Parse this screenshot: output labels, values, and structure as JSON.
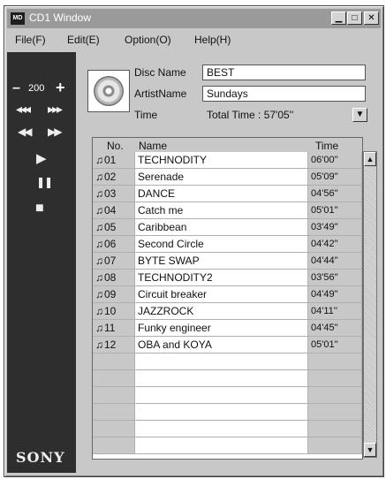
{
  "window": {
    "app_icon": "MD",
    "title": "CD1 Window",
    "min_glyph": "▁",
    "max_glyph": "□",
    "close_glyph": "✕"
  },
  "menu": {
    "file": "File(F)",
    "edit": "Edit(E)",
    "option": "Option(O)",
    "help": "Help(H)"
  },
  "controls": {
    "minus": "–",
    "volume": "200",
    "plus": "+",
    "prev_track": "◂◂◂",
    "next_track": "▸▸▸",
    "rewind": "◀◀",
    "fast_forward": "▶▶",
    "play": "▶",
    "pause": "❚❚",
    "stop": "■",
    "brand": "SONY"
  },
  "disc": {
    "disc_name_label": "Disc Name",
    "disc_name": "BEST",
    "artist_label": "ArtistName",
    "artist": "Sundays",
    "time_label": "Time",
    "time_value": "Total Time : 57'05''",
    "dropdown_glyph": "▼"
  },
  "table": {
    "col_no": "No.",
    "col_name": "Name",
    "col_time": "Time",
    "tracks": [
      {
        "no": "01",
        "name": "TECHNODITY",
        "time": "06'00''"
      },
      {
        "no": "02",
        "name": "Serenade",
        "time": "05'09''"
      },
      {
        "no": "03",
        "name": "DANCE",
        "time": "04'56''"
      },
      {
        "no": "04",
        "name": "Catch me",
        "time": "05'01''"
      },
      {
        "no": "05",
        "name": "Caribbean",
        "time": "03'49''"
      },
      {
        "no": "06",
        "name": "Second Circle",
        "time": "04'42''"
      },
      {
        "no": "07",
        "name": "BYTE SWAP",
        "time": "04'44''"
      },
      {
        "no": "08",
        "name": "TECHNODITY2",
        "time": "03'56''"
      },
      {
        "no": "09",
        "name": "Circuit breaker",
        "time": "04'49''"
      },
      {
        "no": "10",
        "name": "JAZZROCK",
        "time": "04'11''"
      },
      {
        "no": "11",
        "name": "Funky engineer",
        "time": "04'45''"
      },
      {
        "no": "12",
        "name": "OBA and KOYA",
        "time": "05'01''"
      }
    ],
    "note_glyph": "♫",
    "scroll_up": "▲",
    "scroll_down": "▼"
  }
}
